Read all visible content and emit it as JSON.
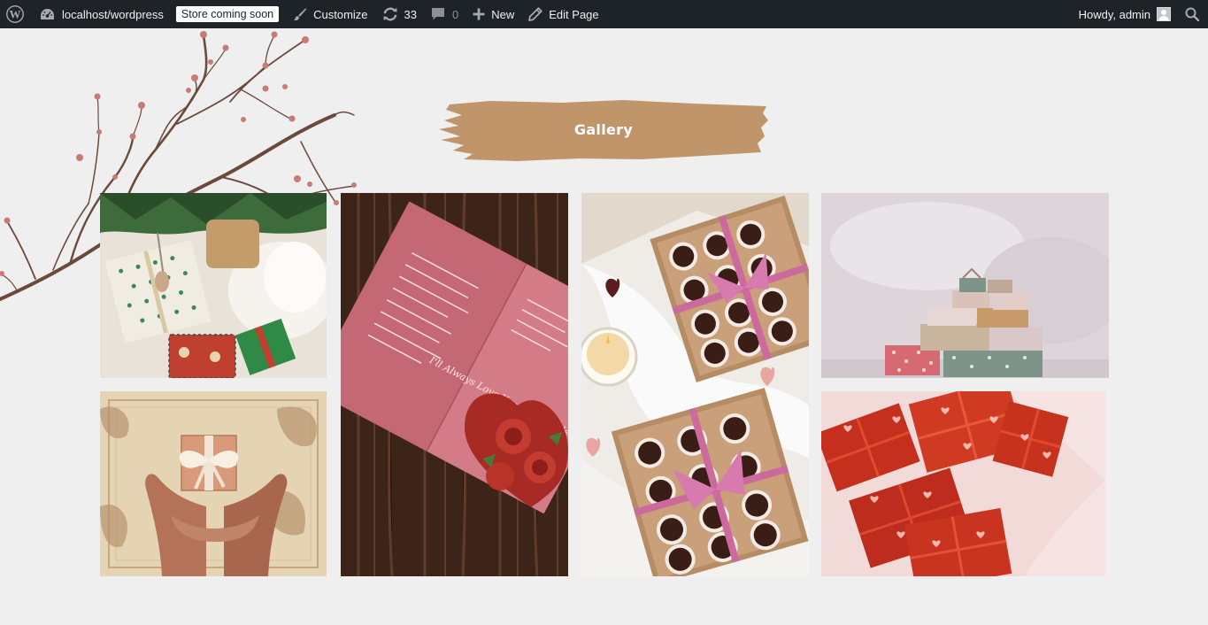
{
  "admin_bar": {
    "site_name": "localhost/wordpress",
    "store_badge": "Store coming soon",
    "customize": "Customize",
    "updates_count": "33",
    "comments_count": "0",
    "new": "New",
    "edit_page": "Edit Page",
    "howdy": "Howdy, admin"
  },
  "section": {
    "title": "Gallery",
    "brush_color": "#c0956a"
  },
  "gallery": [
    {
      "subject": "christmas-gifts-under-tree"
    },
    {
      "subject": "valentines-card",
      "card_text": "I'll Always Love You Happy Valentine's Day"
    },
    {
      "subject": "heart-chocolates-box"
    },
    {
      "subject": "stacked-wrapped-gifts"
    },
    {
      "subject": "hands-holding-gift"
    },
    {
      "subject": "red-heart-wrapped-gifts"
    }
  ],
  "icons": [
    "wordpress-icon",
    "dashboard-icon",
    "brush-icon",
    "updates-icon",
    "comment-icon",
    "plus-icon",
    "pencil-icon",
    "user-avatar-icon",
    "search-icon"
  ]
}
